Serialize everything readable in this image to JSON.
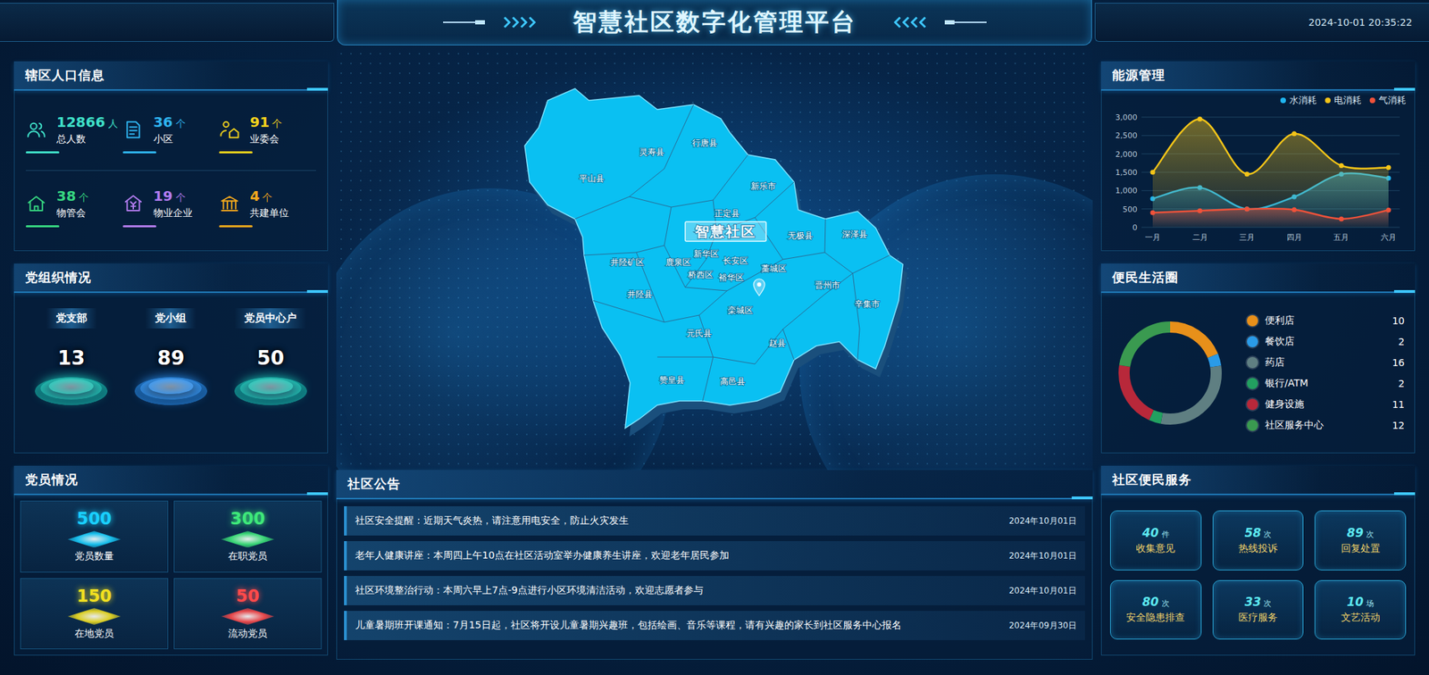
{
  "header": {
    "title": "智慧社区数字化管理平台",
    "datetime": "2024-10-01 20:35:22"
  },
  "population": {
    "title": "辖区人口信息",
    "stats": [
      {
        "value": "12866",
        "unit": "人",
        "label": "总人数",
        "color": "#3fe0c8"
      },
      {
        "value": "36",
        "unit": "个",
        "label": "小区",
        "color": "#2fb4f0"
      },
      {
        "value": "91",
        "unit": "个",
        "label": "业委会",
        "color": "#f2d21c"
      },
      {
        "value": "38",
        "unit": "个",
        "label": "物管会",
        "color": "#36d680"
      },
      {
        "value": "19",
        "unit": "个",
        "label": "物业企业",
        "color": "#b27cf0"
      },
      {
        "value": "4",
        "unit": "个",
        "label": "共建单位",
        "color": "#f2a81c"
      }
    ]
  },
  "party_org": {
    "title": "党组织情况",
    "items": [
      {
        "label": "党支部",
        "value": "13",
        "color": "#19c6b6"
      },
      {
        "label": "党小组",
        "value": "89",
        "color": "#2a8ff0"
      },
      {
        "label": "党员中心户",
        "value": "50",
        "color": "#19c6b6"
      }
    ]
  },
  "party_members": {
    "title": "党员情况",
    "items": [
      {
        "value": "500",
        "label": "党员数量",
        "color": "#19d0ff"
      },
      {
        "value": "300",
        "label": "在职党员",
        "color": "#3ee87a"
      },
      {
        "value": "150",
        "label": "在地党员",
        "color": "#f2e020"
      },
      {
        "value": "50",
        "label": "流动党员",
        "color": "#ff4a4a"
      }
    ]
  },
  "map": {
    "center_label": "智慧社区",
    "districts": [
      "平山县",
      "灵寿县",
      "行唐县",
      "新乐市",
      "正定县",
      "无极县",
      "深泽县",
      "井陉矿区",
      "鹿泉区",
      "新华区",
      "长安区",
      "桥西区",
      "裕华区",
      "藁城区",
      "晋州市",
      "辛集市",
      "井陉县",
      "栾城区",
      "元氏县",
      "赵县",
      "赞皇县",
      "高邑县"
    ]
  },
  "notices": {
    "title": "社区公告",
    "rows": [
      {
        "text": "社区安全提醒：近期天气炎热，请注意用电安全，防止火灾发生",
        "date": "2024年10月01日"
      },
      {
        "text": "老年人健康讲座：本周四上午10点在社区活动室举办健康养生讲座，欢迎老年居民参加",
        "date": "2024年10月01日"
      },
      {
        "text": "社区环境整治行动：本周六早上7点-9点进行小区环境清洁活动，欢迎志愿者参与",
        "date": "2024年10月01日"
      },
      {
        "text": "儿童暑期班开课通知：7月15日起，社区将开设儿童暑期兴趣班，包括绘画、音乐等课程，请有兴趣的家长到社区服务中心报名",
        "date": "2024年09月30日"
      }
    ]
  },
  "energy": {
    "title": "能源管理",
    "y_ticks": [
      "0",
      "500",
      "1,000",
      "1,500",
      "2,000",
      "2,500",
      "3,000"
    ],
    "months": [
      "一月",
      "二月",
      "三月",
      "四月",
      "五月",
      "六月"
    ],
    "series": [
      {
        "name": "水消耗",
        "color": "#1fb5f0",
        "values": [
          780,
          1080,
          500,
          830,
          1450,
          1340
        ]
      },
      {
        "name": "电消耗",
        "color": "#f5c518",
        "values": [
          1500,
          2950,
          1450,
          2550,
          1680,
          1630
        ]
      },
      {
        "name": "气消耗",
        "color": "#f0523a",
        "values": [
          400,
          450,
          500,
          480,
          230,
          470
        ]
      }
    ]
  },
  "life_circle": {
    "title": "便民生活圈",
    "items": [
      {
        "label": "便利店",
        "value": "10",
        "color": "#e8901a"
      },
      {
        "label": "餐饮店",
        "value": "2",
        "color": "#2a9be8"
      },
      {
        "label": "药店",
        "value": "16",
        "color": "#5f7f82"
      },
      {
        "label": "银行/ATM",
        "value": "2",
        "color": "#22a060"
      },
      {
        "label": "健身设施",
        "value": "11",
        "color": "#b8283a"
      },
      {
        "label": "社区服务中心",
        "value": "12",
        "color": "#3a9a50"
      }
    ]
  },
  "services": {
    "title": "社区便民服务",
    "items": [
      {
        "value": "40",
        "unit": "件",
        "label": "收集意见"
      },
      {
        "value": "58",
        "unit": "次",
        "label": "热线投诉"
      },
      {
        "value": "89",
        "unit": "次",
        "label": "回复处置"
      },
      {
        "value": "80",
        "unit": "次",
        "label": "安全隐患排查"
      },
      {
        "value": "33",
        "unit": "次",
        "label": "医疗服务"
      },
      {
        "value": "10",
        "unit": "场",
        "label": "文艺活动"
      }
    ]
  }
}
